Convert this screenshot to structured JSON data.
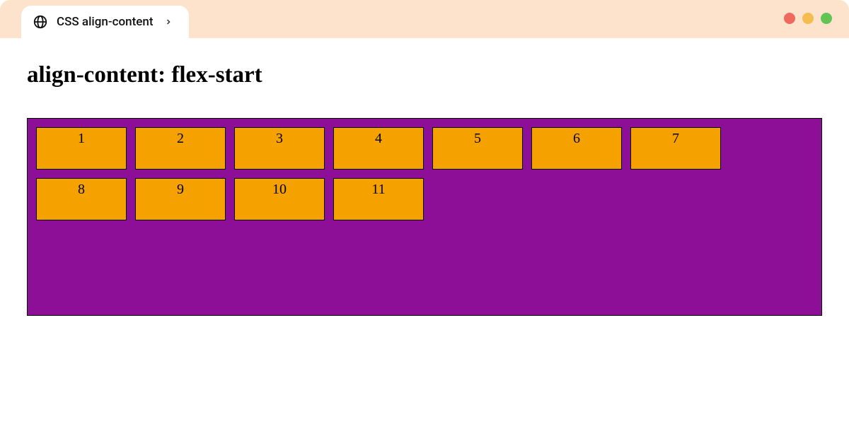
{
  "tab": {
    "title": "CSS align-content"
  },
  "heading": "align-content: flex-start",
  "items": [
    "1",
    "2",
    "3",
    "4",
    "5",
    "6",
    "7",
    "8",
    "9",
    "10",
    "11"
  ],
  "colors": {
    "container_bg": "#8e0f97",
    "item_bg": "#f5a100",
    "chrome_bg": "#fde3cb"
  }
}
